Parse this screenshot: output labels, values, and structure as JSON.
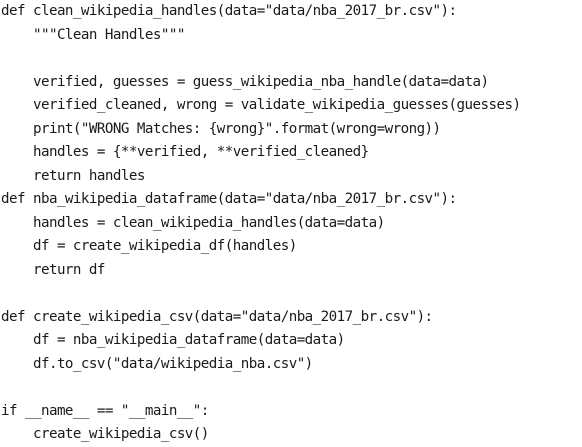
{
  "code": {
    "lines": [
      "def clean_wikipedia_handles(data=\"data/nba_2017_br.csv\"):",
      "    \"\"\"Clean Handles\"\"\"",
      "",
      "    verified, guesses = guess_wikipedia_nba_handle(data=data)",
      "    verified_cleaned, wrong = validate_wikipedia_guesses(guesses)",
      "    print(\"WRONG Matches: {wrong}\".format(wrong=wrong))",
      "    handles = {**verified, **verified_cleaned}",
      "    return handles",
      "def nba_wikipedia_dataframe(data=\"data/nba_2017_br.csv\"):",
      "    handles = clean_wikipedia_handles(data=data)",
      "    df = create_wikipedia_df(handles)",
      "    return df",
      "",
      "def create_wikipedia_csv(data=\"data/nba_2017_br.csv\"):",
      "    df = nba_wikipedia_dataframe(data=data)",
      "    df.to_csv(\"data/wikipedia_nba.csv\")",
      "",
      "if __name__ == \"__main__\":",
      "    create_wikipedia_csv()"
    ]
  }
}
